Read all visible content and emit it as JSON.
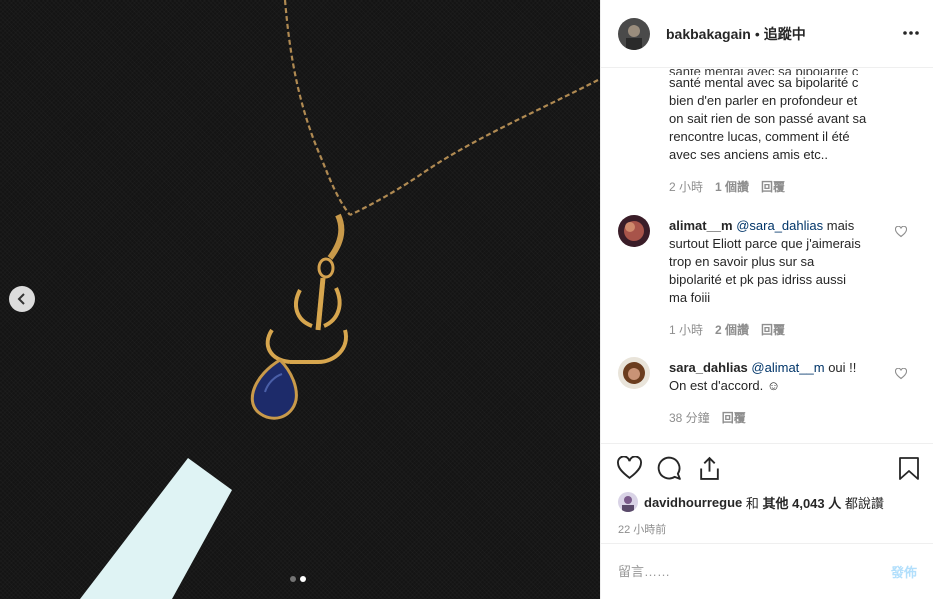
{
  "post": {
    "photo_alt": "pendant",
    "carousel": {
      "total": 2,
      "active_index": 1
    }
  },
  "header": {
    "username": "bakbakagain",
    "separator": "•",
    "follow_status": "追蹤中",
    "more_icon": "more-horizontal-icon"
  },
  "comments": [
    {
      "text_lines": [
        "santé mental avec sa bipolarité c",
        "bien d'en parler en profondeur et",
        "on sait rien de son passé avant sa",
        "rencontre lucas, comment il été",
        "avec ses anciens amis etc.."
      ],
      "meta": {
        "time": "2 小時",
        "replies": "1 個讚",
        "reply": "回覆"
      }
    },
    {
      "user": "alimat__m",
      "mention": "@sara_dahlias",
      "text_first": " mais",
      "text_lines": [
        "surtout Eliott parce que j'aimerais",
        "trop en savoir plus sur sa",
        "bipolarité et pk pas idriss aussi",
        "ma foiii"
      ],
      "meta": {
        "time": "1 小時",
        "replies": "2 個讚",
        "reply": "回覆"
      }
    },
    {
      "user": "sara_dahlias",
      "mention": "@alimat__m",
      "text_first": " oui !!",
      "text_lines": [
        "On est d'accord. ☺"
      ],
      "meta": {
        "time": "38 分鐘",
        "reply": "回覆"
      }
    }
  ],
  "actions": {
    "like_icon": "heart-icon",
    "comment_icon": "comment-icon",
    "share_icon": "share-icon",
    "save_icon": "bookmark-icon"
  },
  "likes": {
    "first_user": "davidhourregue",
    "connector": " 和 ",
    "others": "其他 4,043 人",
    "suffix": " 都說讚"
  },
  "timestamp": "22 小時前",
  "add_comment": {
    "placeholder": "留言……",
    "post_label": "發佈"
  },
  "colors": {
    "mention": "#003569",
    "post_button": "#b2dffc",
    "meta_gray": "#8e8e8e"
  }
}
